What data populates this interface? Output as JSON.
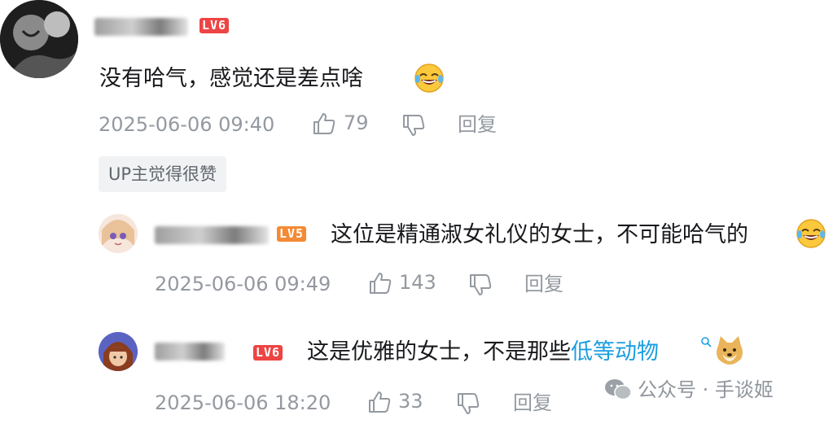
{
  "comments": [
    {
      "level": "LV6",
      "text": "没有哈气，感觉还是差点啥",
      "timestamp": "2025-06-06 09:40",
      "likes": "79",
      "reply_label": "回复",
      "tag": "UP主觉得很赞",
      "emoji": "laughing-crying-emoji"
    },
    {
      "level": "LV5",
      "text": "这位是精通淑女礼仪的女士，不可能哈气的",
      "timestamp": "2025-06-06 09:49",
      "likes": "143",
      "reply_label": "回复",
      "emoji": "laughing-crying-emoji"
    },
    {
      "level": "LV6",
      "text_prefix": "这是优雅的女士，不是那些",
      "link_text": "低等动物",
      "timestamp": "2025-06-06 18:20",
      "likes": "33",
      "reply_label": "回复",
      "emoji": "doge-emoji"
    }
  ],
  "watermark": "公众号 · 手谈姬",
  "colors": {
    "text": "#18191c",
    "meta": "#9499a0",
    "link": "#1b9fe1",
    "level_red": "#ee4444",
    "level_orange": "#f48a35"
  }
}
